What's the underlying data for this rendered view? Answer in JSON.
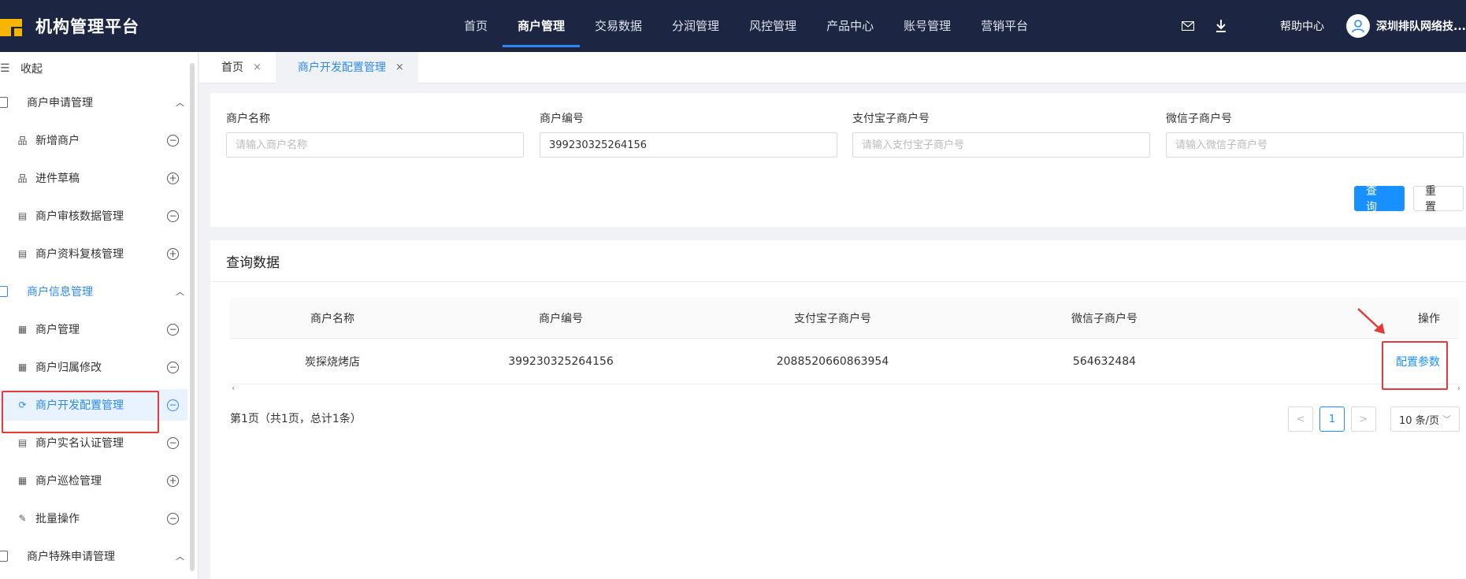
{
  "app": {
    "title": "机构管理平台"
  },
  "topnav": {
    "items": [
      "首页",
      "商户管理",
      "交易数据",
      "分润管理",
      "风控管理",
      "产品中心",
      "账号管理",
      "营销平台"
    ],
    "active_index": 1
  },
  "topright": {
    "help": "帮助中心",
    "company": "深圳排队网络技..."
  },
  "sidebar": {
    "collapse_label": "收起",
    "groups": [
      {
        "label": "商户申请管理",
        "expanded": true
      },
      {
        "label": "商户信息管理",
        "expanded": true
      },
      {
        "label": "商户特殊申请管理",
        "expanded": true
      }
    ],
    "apply_items": [
      {
        "label": "新增商户",
        "state": "minus"
      },
      {
        "label": "进件草稿",
        "state": "plus"
      },
      {
        "label": "商户审核数据管理",
        "state": "minus"
      },
      {
        "label": "商户资料复核管理",
        "state": "plus"
      }
    ],
    "info_items": [
      {
        "label": "商户管理",
        "state": "minus"
      },
      {
        "label": "商户归属修改",
        "state": "minus"
      },
      {
        "label": "商户开发配置管理",
        "state": "minus",
        "active": true
      },
      {
        "label": "商户实名认证管理",
        "state": "minus"
      },
      {
        "label": "商户巡检管理",
        "state": "plus"
      },
      {
        "label": "批量操作",
        "state": "minus"
      }
    ]
  },
  "tabs": [
    {
      "label": "首页",
      "close": "×"
    },
    {
      "label": "商户开发配置管理",
      "close": "×",
      "active": true
    }
  ],
  "search": {
    "fields": [
      {
        "label": "商户名称",
        "value": "",
        "placeholder": "请输入商户名称"
      },
      {
        "label": "商户编号",
        "value": "399230325264156",
        "placeholder": ""
      },
      {
        "label": "支付宝子商户号",
        "value": "",
        "placeholder": "请输入支付宝子商户号"
      },
      {
        "label": "微信子商户号",
        "value": "",
        "placeholder": "请输入微信子商户号"
      }
    ],
    "query_label": "查询",
    "reset_label": "重置"
  },
  "results": {
    "title": "查询数据",
    "columns": [
      "商户名称",
      "商户编号",
      "支付宝子商户号",
      "微信子商户号",
      "操作"
    ],
    "rows": [
      {
        "name": "炭探烧烤店",
        "id": "399230325264156",
        "alipay": "2088520660863954",
        "wechat": "564632484",
        "action": "配置参数"
      }
    ],
    "page_info": "第1页（共1页，总计1条）",
    "current_page": "1",
    "page_size": "10 条/页",
    "prev": "<",
    "next": ">"
  },
  "colors": {
    "accent": "#1890ff",
    "header_bg": "#1c2541",
    "highlight": "#e33a3a",
    "logo": "#f7b500"
  }
}
